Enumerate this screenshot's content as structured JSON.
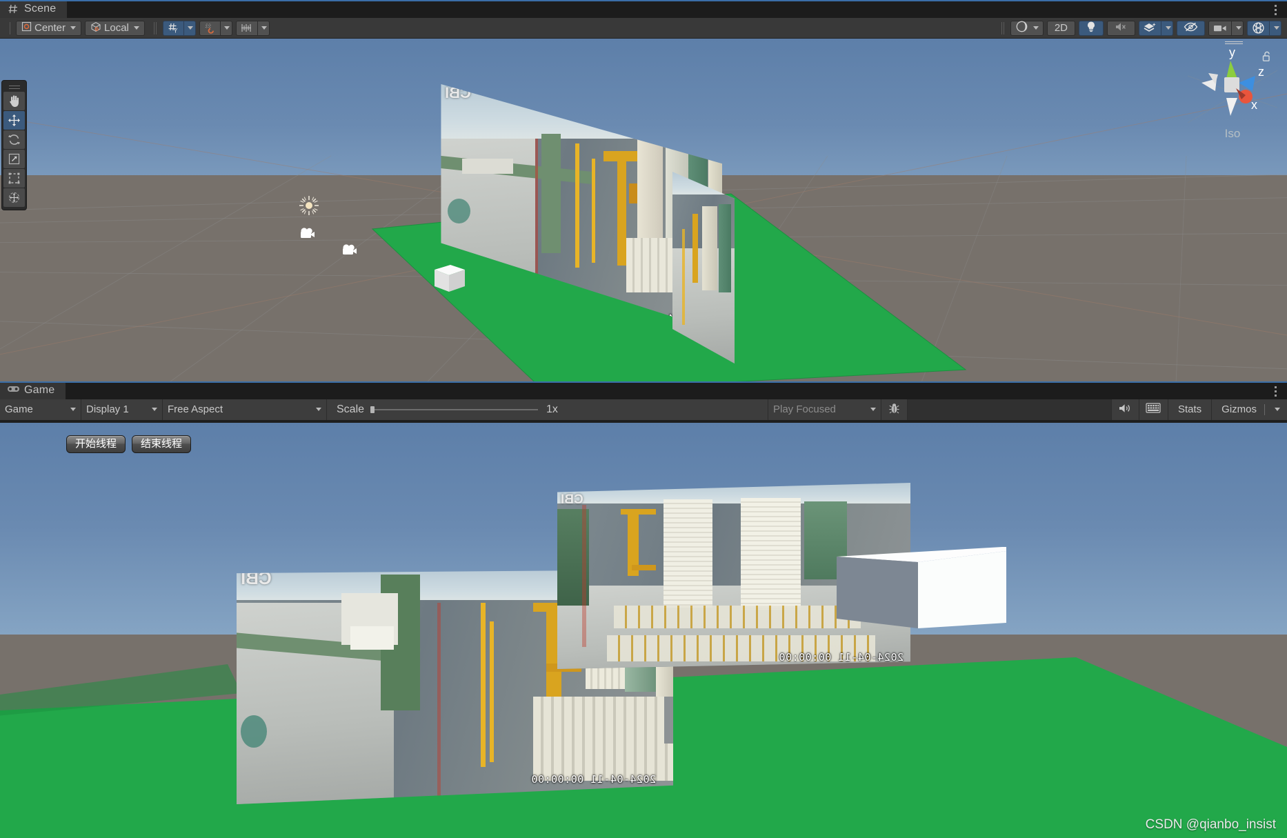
{
  "app": "Unity Editor",
  "scene_panel": {
    "tab": {
      "label": "Scene",
      "icon": "grid-hash-icon"
    },
    "kebab": "more-options-icon",
    "toolbar": {
      "pivot_mode": {
        "label": "Center",
        "icon": "pivot-center-icon",
        "dropdown": "chevron-down-icon"
      },
      "handle_space": {
        "label": "Local",
        "icon": "cube-local-icon",
        "dropdown": "chevron-down-icon"
      },
      "grid_snapping": {
        "icon": "grid-snap-icon",
        "active": true,
        "dropdown": "chevron-down-icon"
      },
      "magnet_snapping": {
        "icon": "magnet-snap-icon",
        "active": false,
        "dropdown": "chevron-down-icon"
      },
      "grid_visibility": {
        "icon": "grid-axis-icon",
        "active": false,
        "dropdown": "chevron-down-icon"
      },
      "right_controls": [
        {
          "name": "shading-mode",
          "icon": "sphere-shading-icon",
          "label": "",
          "active": false,
          "dropdown": true
        },
        {
          "name": "2d-toggle",
          "icon": "",
          "label": "2D",
          "active": false,
          "dropdown": false
        },
        {
          "name": "scene-lighting",
          "icon": "lightbulb-icon",
          "label": "",
          "active": true,
          "dropdown": false
        },
        {
          "name": "scene-audio",
          "icon": "audio-muted-icon",
          "label": "",
          "active": false,
          "dropdown": false
        },
        {
          "name": "fx-effects",
          "icon": "layers-fx-icon",
          "label": "",
          "active": true,
          "dropdown": true
        },
        {
          "name": "scene-visibility",
          "icon": "eye-hidden-icon",
          "label": "",
          "active": true,
          "dropdown": false
        },
        {
          "name": "camera-settings",
          "icon": "camera-icon",
          "label": "",
          "active": false,
          "dropdown": true
        },
        {
          "name": "gizmos-toggle",
          "icon": "gizmo-globe-icon",
          "label": "",
          "active": true,
          "dropdown": true
        }
      ]
    },
    "tools": [
      {
        "name": "hand-tool",
        "icon": "hand-icon",
        "selected": false
      },
      {
        "name": "move-tool",
        "icon": "move-arrows-icon",
        "selected": true
      },
      {
        "name": "rotate-tool",
        "icon": "rotate-icon",
        "selected": false
      },
      {
        "name": "scale-tool",
        "icon": "scale-icon",
        "selected": false
      },
      {
        "name": "rect-tool",
        "icon": "rect-transform-icon",
        "selected": false
      },
      {
        "name": "transform-tool",
        "icon": "transform-icon",
        "selected": false
      }
    ],
    "gizmo": {
      "axes": {
        "x": "x",
        "y": "y",
        "z": "z"
      },
      "projection": "Iso",
      "lock": "unlocked-padlock-icon",
      "colors": {
        "x": "#e9553c",
        "y": "#8ccd3f",
        "z": "#3d8fe0"
      }
    },
    "scene_objects": {
      "directional_light": "sun-gizmo-icon",
      "camera_1": "camera-gizmo-icon",
      "camera_2": "camera-gizmo-icon",
      "cube": "white-cube",
      "plane": "green-plane",
      "video_quad_1": "video-wall-left",
      "video_quad_2": "video-wall-right"
    }
  },
  "game_panel": {
    "tab": {
      "label": "Game",
      "icon": "gamepad-icon"
    },
    "kebab": "more-options-icon",
    "toolbar": {
      "view_mode": {
        "value": "Game",
        "dropdown": "chevron-down-icon"
      },
      "display": {
        "value": "Display 1",
        "dropdown": "chevron-down-icon"
      },
      "aspect": {
        "value": "Free Aspect",
        "dropdown": "chevron-down-icon"
      },
      "scale": {
        "label": "Scale",
        "value": "1x",
        "slider_pct": 0
      },
      "play_mode": {
        "value": "Play Focused",
        "dropdown": "chevron-down-icon"
      },
      "debug": {
        "icon": "bug-icon"
      },
      "mute_audio": {
        "icon": "speaker-icon"
      },
      "render_doc": {
        "icon": "frame-capture-icon"
      },
      "stats": {
        "label": "Stats"
      },
      "gizmos": {
        "label": "Gizmos",
        "dropdown": "chevron-down-icon"
      }
    },
    "ui_buttons": [
      {
        "name": "start-thread-button",
        "label": "开始线程"
      },
      {
        "name": "end-thread-button",
        "label": "结束线程"
      }
    ],
    "rendered_objects": {
      "video_quad_left": "video-wall-left",
      "video_quad_right": "video-wall-right",
      "cube": "white-cube",
      "plane": "green-plane"
    }
  },
  "video_overlay": {
    "timestamp": "2024-04-11 00:00:00",
    "camera_label": "CBI",
    "content": "port container terminal CCTV footage"
  },
  "watermark": "CSDN @qianbo_insist",
  "colors": {
    "accent_blue": "#3b5a7d",
    "panel_bg": "#393939",
    "tab_bg": "#353535",
    "chrome_dark": "#1c1c1c",
    "plane_green": "#22a84a",
    "ground_brown": "#77716b",
    "sky_top": "#5d7fa9"
  }
}
